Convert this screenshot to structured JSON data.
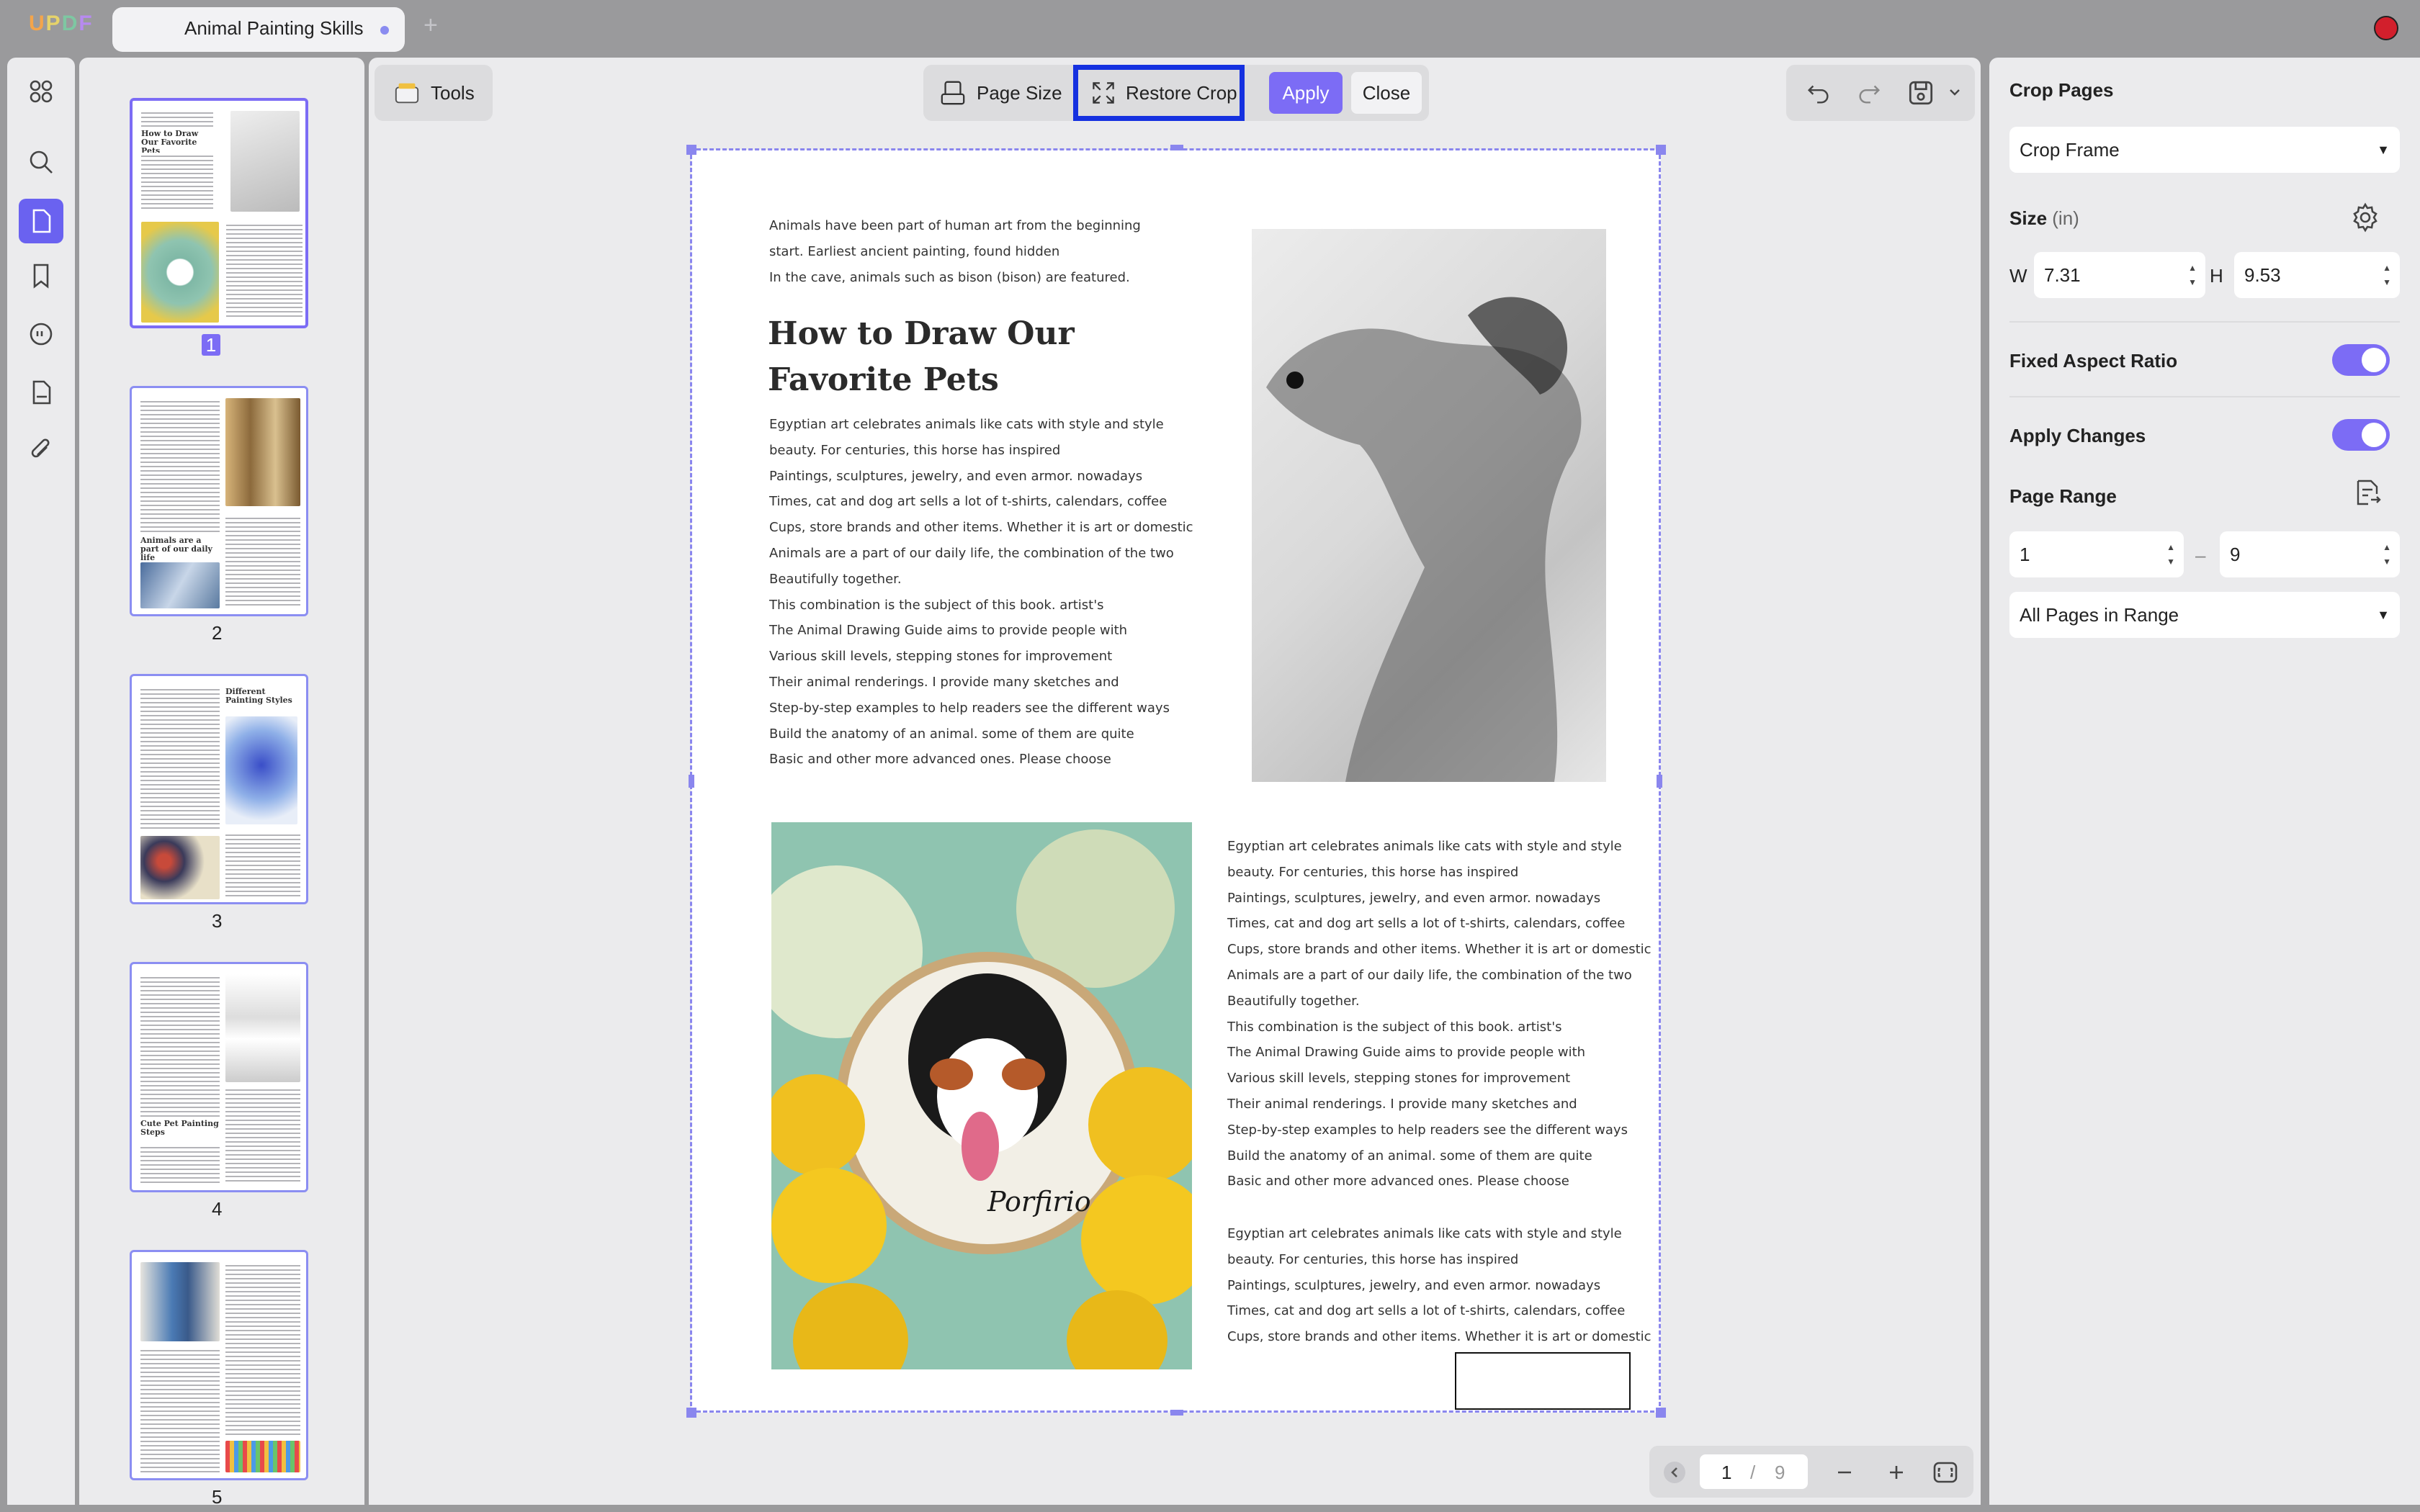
{
  "app": {
    "logo_letters": [
      "U",
      "P",
      "D",
      "F"
    ]
  },
  "tabs": [
    {
      "title": "Animal Painting Skills",
      "modified": true
    }
  ],
  "left_rail": {
    "icons": [
      "grid-icon",
      "search-icon",
      "pages-icon",
      "bookmark-icon",
      "comment-icon",
      "form-icon",
      "attachment-icon"
    ],
    "active": "pages-icon"
  },
  "thumbnails": {
    "pages": [
      "1",
      "2",
      "3",
      "4",
      "5"
    ],
    "active": "1",
    "headings": {
      "p1": "How to Draw Our Favorite Pets",
      "p2": "Animals are a part of our daily life",
      "p3": "Different Painting Styles",
      "p4": "Cute Pet Painting Steps"
    }
  },
  "toolbar": {
    "tools_label": "Tools",
    "page_size_label": "Page Size",
    "restore_crop_label": "Restore Crop",
    "apply_label": "Apply",
    "close_label": "Close"
  },
  "document": {
    "intro": "Animals have been part of human art from the beginning\nstart. Earliest ancient painting, found hidden\nIn the cave, animals such as bison (bison) are featured.",
    "heading": "How to Draw Our\nFavorite Pets",
    "body_left": "Egyptian art celebrates animals like cats with style and style\nbeauty. For centuries, this horse has inspired\nPaintings, sculptures, jewelry, and even armor. nowadays\nTimes, cat and dog art sells a lot of t-shirts, calendars, coffee\nCups, store brands and other items. Whether it is art or domestic\nAnimals are a part of our daily life, the combination of the two\nBeautifully together.\nThis combination is the subject of this book. artist's\nThe Animal Drawing Guide aims to provide people with\nVarious skill levels, stepping stones for improvement\nTheir animal renderings. I provide many sketches and\nStep-by-step examples to help readers see the different ways\nBuild the anatomy of an animal. some of them are quite\nBasic and other more advanced ones. Please choose",
    "body_right": "Egyptian art celebrates animals like cats with style and style\nbeauty. For centuries, this horse has inspired\nPaintings, sculptures, jewelry, and even armor. nowadays\nTimes, cat and dog art sells a lot of t-shirts, calendars, coffee\nCups, store brands and other items. Whether it is art or domestic\nAnimals are a part of our daily life, the combination of the two\nBeautifully together.\nThis combination is the subject of this book. artist's\nThe Animal Drawing Guide aims to provide people with\nVarious skill levels, stepping stones for improvement\nTheir animal renderings. I provide many sketches and\nStep-by-step examples to help readers see the different ways\nBuild the anatomy of an animal. some of them are quite\nBasic and other more advanced ones. Please choose",
    "body_right2": "Egyptian art celebrates animals like cats with style and style\nbeauty. For centuries, this horse has inspired\nPaintings, sculptures, jewelry, and even armor. nowadays\nTimes, cat and dog art sells a lot of t-shirts, calendars, coffee\nCups, store brands and other items. Whether it is art or domestic",
    "embroidery_text": "Porfirio"
  },
  "pager": {
    "current": "1",
    "separator": "/",
    "total": "9"
  },
  "crop_panel": {
    "title": "Crop Pages",
    "mode": "Crop Frame",
    "size_label": "Size",
    "size_unit": "(in)",
    "width_label": "W",
    "width_value": "7.31",
    "height_label": "H",
    "height_value": "9.53",
    "fixed_aspect_label": "Fixed Aspect Ratio",
    "fixed_aspect_on": true,
    "apply_changes_label": "Apply Changes",
    "apply_changes_on": true,
    "page_range_label": "Page Range",
    "range_from": "1",
    "range_dash": "–",
    "range_to": "9",
    "range_mode": "All Pages in Range"
  },
  "colors": {
    "accent": "#7c6cf5",
    "highlight": "#1531e0",
    "crop_frame": "#8a86ee"
  }
}
